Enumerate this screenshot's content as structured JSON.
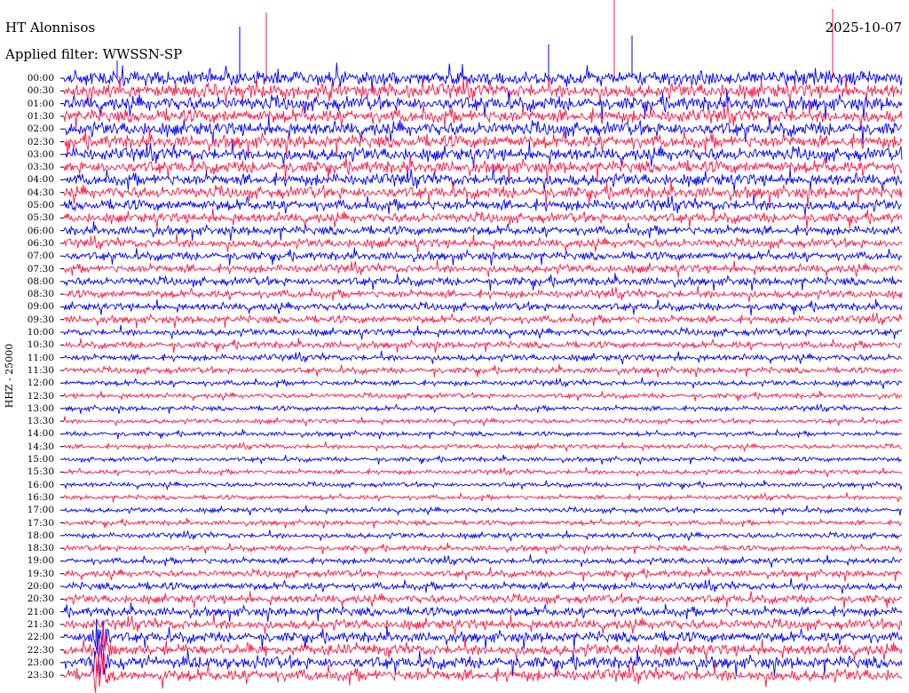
{
  "header": {
    "station": "HT Alonnisos",
    "filter": "Applied filter: WWSSN-SP",
    "date": "2025-10-07"
  },
  "chart_data": {
    "type": "helicorder",
    "ylabel": "HHZ - 25000",
    "rows": [
      "00:00",
      "00:30",
      "01:00",
      "01:30",
      "02:00",
      "02:30",
      "03:00",
      "03:30",
      "04:00",
      "04:30",
      "05:00",
      "05:30",
      "06:00",
      "06:30",
      "07:00",
      "07:30",
      "08:00",
      "08:30",
      "09:00",
      "09:30",
      "10:00",
      "10:30",
      "11:00",
      "11:30",
      "12:00",
      "12:30",
      "13:00",
      "13:30",
      "14:00",
      "14:30",
      "15:00",
      "15:30",
      "16:00",
      "16:30",
      "17:00",
      "17:30",
      "18:00",
      "18:30",
      "19:00",
      "19:30",
      "20:00",
      "20:30",
      "21:00",
      "21:30",
      "22:00",
      "22:30",
      "23:00",
      "23:30"
    ],
    "trace_colors": [
      "#0000ff",
      "#ff1744"
    ],
    "relative_amplitude": [
      0.95,
      0.95,
      0.92,
      0.9,
      0.9,
      0.88,
      0.85,
      0.82,
      0.8,
      0.78,
      0.72,
      0.65,
      0.6,
      0.58,
      0.55,
      0.55,
      0.55,
      0.52,
      0.5,
      0.5,
      0.45,
      0.45,
      0.42,
      0.4,
      0.35,
      0.32,
      0.32,
      0.3,
      0.3,
      0.3,
      0.3,
      0.3,
      0.3,
      0.3,
      0.32,
      0.32,
      0.35,
      0.35,
      0.4,
      0.45,
      0.5,
      0.55,
      0.6,
      0.65,
      0.7,
      0.75,
      0.8,
      0.8
    ],
    "events": [
      {
        "time": "22:00",
        "minute_offset": 1.3,
        "amplitude": 3.5
      }
    ]
  }
}
